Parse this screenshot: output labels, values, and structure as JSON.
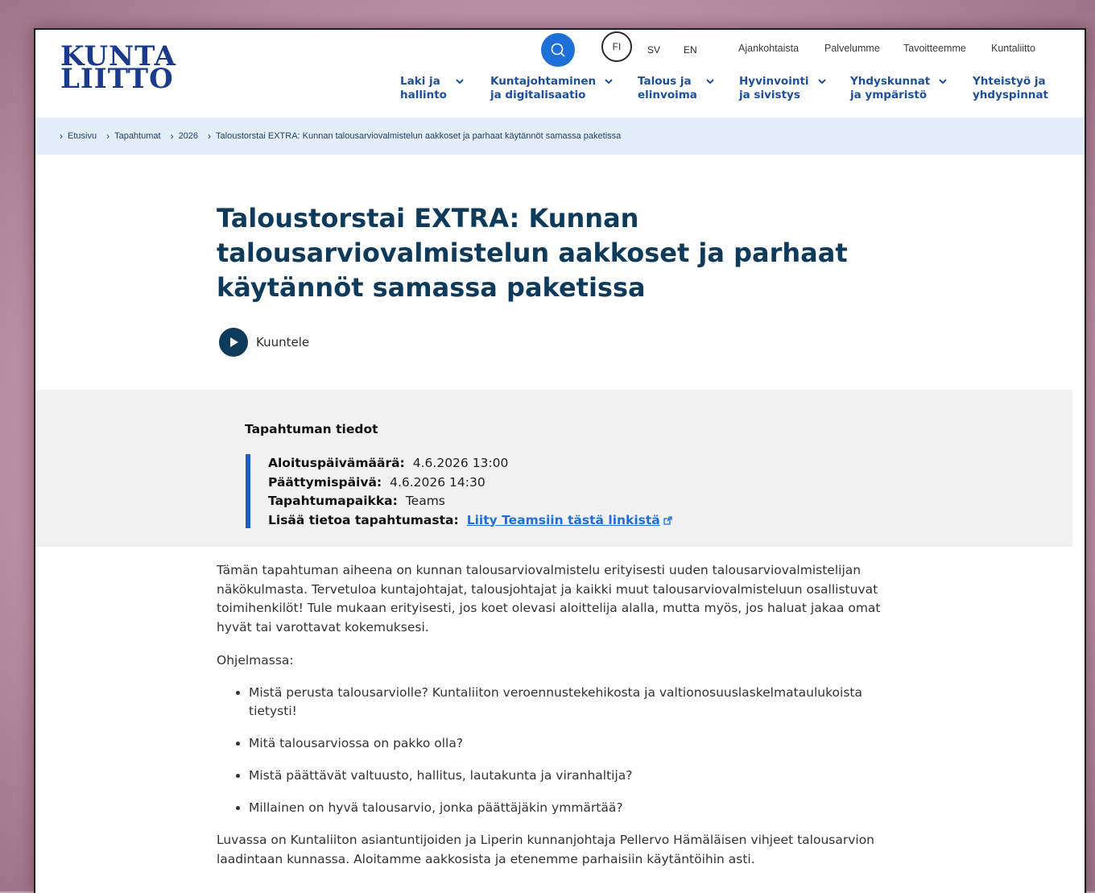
{
  "logo": {
    "line1": "KUNTA",
    "line2": "LIITTO"
  },
  "header": {
    "languages": [
      "FI",
      "SV",
      "EN"
    ],
    "utility_links": [
      "Ajankohtaista",
      "Palvelumme",
      "Tavoitteemme",
      "Kuntaliitto"
    ],
    "nav": [
      {
        "line1": "Laki ja",
        "line2": "hallinto"
      },
      {
        "line1": "Kuntajohtaminen",
        "line2": "ja digitalisaatio"
      },
      {
        "line1": "Talous ja",
        "line2": "elinvoima"
      },
      {
        "line1": "Hyvinvointi",
        "line2": "ja sivistys"
      },
      {
        "line1": "Yhdyskunnat",
        "line2": "ja ympäristö"
      },
      {
        "line1": "Yhteistyö ja",
        "line2": "yhdyspinnat"
      }
    ]
  },
  "breadcrumb": [
    "Etusivu",
    "Tapahtumat",
    "2026",
    "Taloustorstai EXTRA: Kunnan talousarviovalmistelun aakkoset ja parhaat käytännöt samassa paketissa"
  ],
  "page": {
    "title_lines": [
      "Taloustorstai EXTRA: Kunnan",
      "talousarviovalmistelun aakkoset ja parhaat",
      "käytännöt samassa paketissa"
    ],
    "listen_label": "Kuuntele"
  },
  "event": {
    "heading": "Tapahtuman tiedot",
    "start_label": "Aloituspäivämäärä:",
    "start_value": "4.6.2026 13:00",
    "end_label": "Päättymispäivä:",
    "end_value": "4.6.2026 14:30",
    "place_label": "Tapahtumapaikka:",
    "place_value": "Teams",
    "more_label": "Lisää tietoa tapahtumasta:",
    "more_link": "Liity Teamsiin tästä linkistä"
  },
  "body": {
    "intro": "Tämän tapahtuman aiheena on kunnan talousarviovalmistelu erityisesti uuden talousarviovalmistelijan näkökulmasta. Tervetuloa kuntajohtajat, talousjohtajat ja kaikki muut talousarviovalmisteluun osallistuvat toimihenkilöt! Tule mukaan erityisesti, jos koet olevasi aloittelija alalla, mutta myös, jos haluat jakaa omat hyvät tai varottavat kokemuksesi.",
    "program_heading": "Ohjelmassa:",
    "program_items": [
      "Mistä perusta talousarviolle? Kuntaliiton veroennustekehikosta ja valtionosuuslaskelmataulukoista tietysti!",
      "Mitä talousarviossa on pakko olla?",
      "Mistä päättävät valtuusto, hallitus, lautakunta ja viranhaltija?",
      "Millainen on hyvä talousarvio, jonka päättäjäkin ymmärtää?"
    ],
    "outro": "Luvassa on Kuntaliiton asiantuntijoiden ja Liperin kunnanjohtaja Pellervo Hämäläisen vihjeet talousarvion laadintaan kunnassa. Aloitamme aakkosista ja etenemme parhaisiin käytäntöihin asti."
  }
}
